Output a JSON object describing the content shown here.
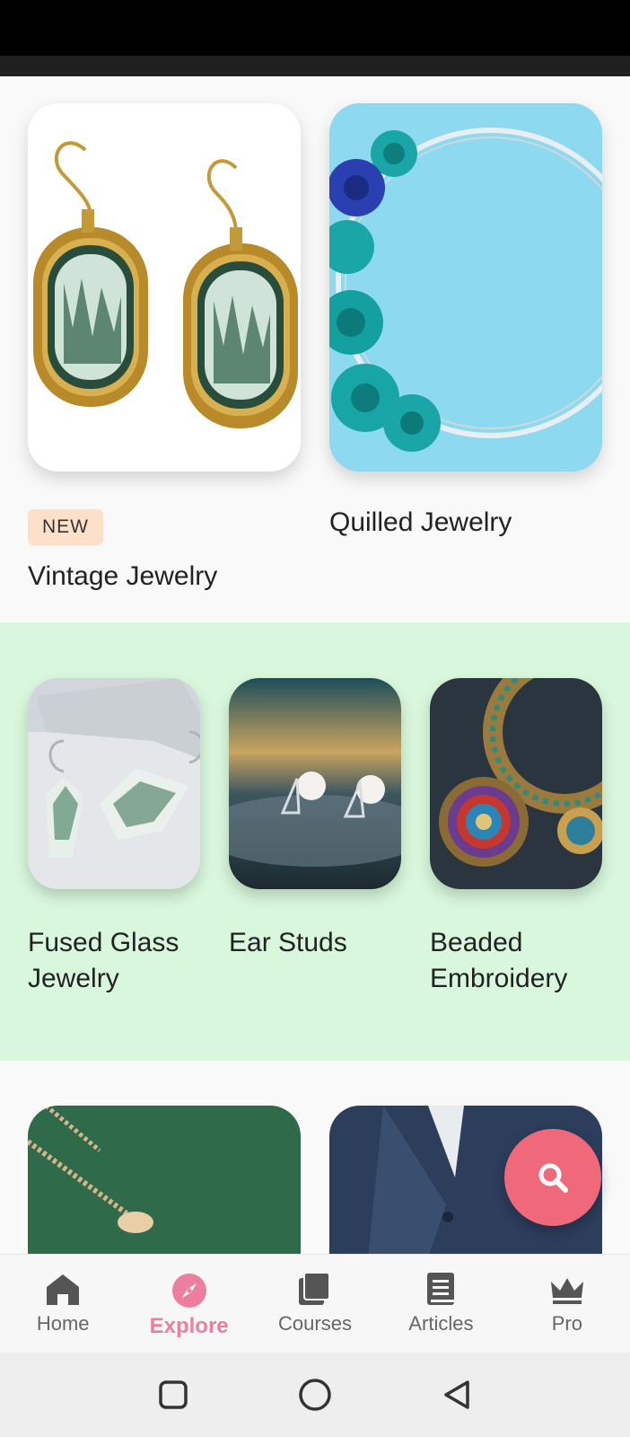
{
  "featured": [
    {
      "title": "Vintage Jewelry",
      "badge": "NEW",
      "image": "gold-earrings-green-stone"
    },
    {
      "title": "Quilled Jewelry",
      "image": "paper-quilled-roses-ring"
    }
  ],
  "collection": {
    "background": "#d9f7dc",
    "items": [
      {
        "title": "Fused Glass Jewelry",
        "image": "glass-stone-earrings"
      },
      {
        "title": "Ear Studs",
        "image": "pearl-ear-studs"
      },
      {
        "title": "Beaded Embroidery",
        "image": "beaded-necklace"
      }
    ]
  },
  "more": [
    {
      "image": "gold-chain-necklace"
    },
    {
      "image": "blue-suit-jacket"
    }
  ],
  "fab": {
    "icon": "search-icon",
    "color": "#f0697a"
  },
  "nav": {
    "active_color": "#ec7f9e",
    "items": [
      {
        "label": "Home",
        "icon": "home-icon"
      },
      {
        "label": "Explore",
        "icon": "compass-icon",
        "active": true
      },
      {
        "label": "Courses",
        "icon": "courses-icon"
      },
      {
        "label": "Articles",
        "icon": "book-icon"
      },
      {
        "label": "Pro",
        "icon": "crown-icon"
      }
    ]
  },
  "system_nav": [
    "recents-button",
    "home-button",
    "back-button"
  ]
}
